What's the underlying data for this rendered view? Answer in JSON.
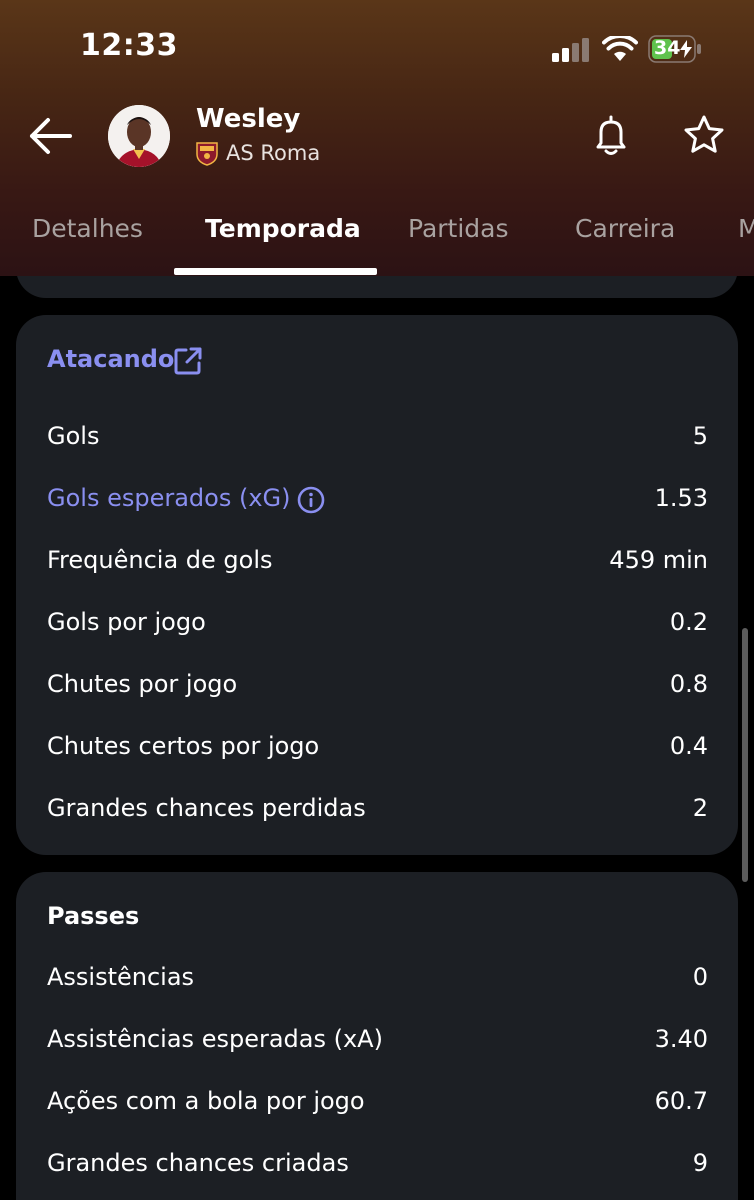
{
  "status_bar": {
    "time": "12:33",
    "battery": "34"
  },
  "header": {
    "player_name": "Wesley",
    "club_name": "AS Roma",
    "accent_color": "#8a8ff0"
  },
  "tabs": [
    {
      "label": "Detalhes",
      "active": false
    },
    {
      "label": "Temporada",
      "active": true
    },
    {
      "label": "Partidas",
      "active": false
    },
    {
      "label": "Carreira",
      "active": false
    },
    {
      "label": "M",
      "active": false
    }
  ],
  "attacking": {
    "title": "Atacando",
    "rows": [
      {
        "label": "Gols",
        "value": "5"
      },
      {
        "label": "Gols esperados (xG)",
        "value": "1.53"
      },
      {
        "label": "Frequência de gols",
        "value": "459 min"
      },
      {
        "label": "Gols por jogo",
        "value": "0.2"
      },
      {
        "label": "Chutes por jogo",
        "value": "0.8"
      },
      {
        "label": "Chutes certos por jogo",
        "value": "0.4"
      },
      {
        "label": "Grandes chances perdidas",
        "value": "2"
      }
    ]
  },
  "passes": {
    "title": "Passes",
    "rows": [
      {
        "label": "Assistências",
        "value": "0"
      },
      {
        "label": "Assistências esperadas (xA)",
        "value": "3.40"
      },
      {
        "label": "Ações com a bola por jogo",
        "value": "60.7"
      },
      {
        "label": "Grandes chances criadas",
        "value": "9"
      }
    ]
  },
  "icons": {
    "back": "arrow-left-icon",
    "notify": "bell-icon",
    "favorite": "star-icon",
    "external": "external-link-icon",
    "info": "info-icon"
  }
}
